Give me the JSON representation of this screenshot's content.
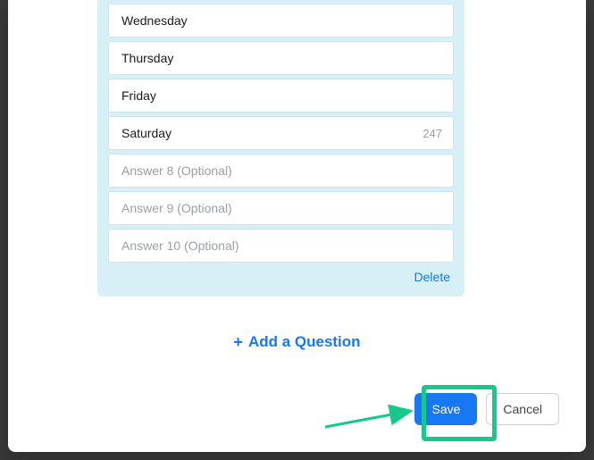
{
  "answers": {
    "a4": {
      "value": "Wednesday"
    },
    "a5": {
      "value": "Thursday"
    },
    "a6": {
      "value": "Friday"
    },
    "a7": {
      "value": "Saturday",
      "counter": "247"
    },
    "a8": {
      "placeholder": "Answer 8 (Optional)"
    },
    "a9": {
      "placeholder": "Answer 9 (Optional)"
    },
    "a10": {
      "placeholder": "Answer 10 (Optional)"
    }
  },
  "delete_label": "Delete",
  "add_question_label": "Add a Question",
  "buttons": {
    "save": "Save",
    "cancel": "Cancel"
  },
  "colors": {
    "panel_bg": "#d6f0f6",
    "link": "#1877f2",
    "highlight": "#14c98b"
  }
}
